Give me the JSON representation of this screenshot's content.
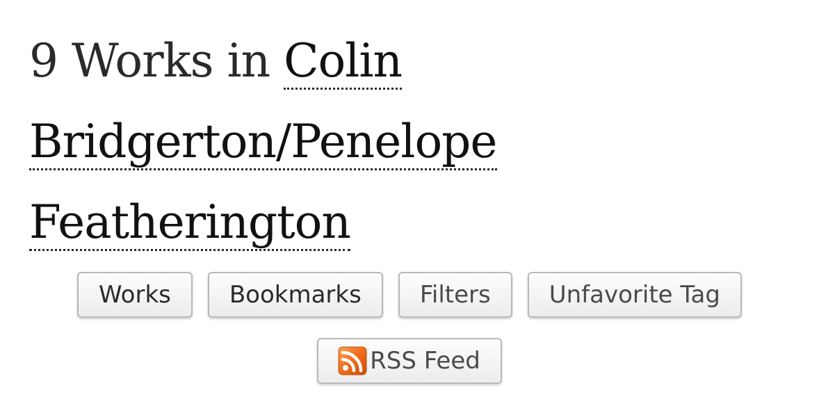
{
  "heading": {
    "prefix": "9 Works in ",
    "tag_line1": "Colin",
    "tag_line2": "Bridgerton/Penelope",
    "tag_line3": "Featherington"
  },
  "actions": {
    "works_label": "Works",
    "bookmarks_label": "Bookmarks",
    "filters_label": "Filters",
    "unfavorite_label": "Unfavorite Tag",
    "rss_label": "RSS Feed"
  },
  "icons": {
    "rss": "rss-icon"
  },
  "colors": {
    "rss_orange": "#f26a1b",
    "text": "#2a2a2a"
  }
}
